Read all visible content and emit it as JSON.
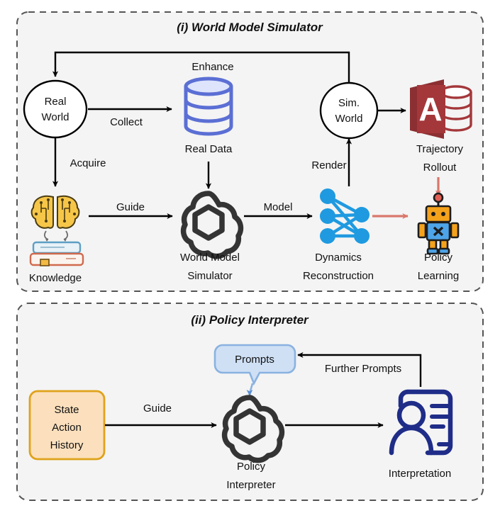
{
  "figure": {
    "background": "#ffffff",
    "panel_fill": "#f4f4f4",
    "panel_border": "#555555"
  },
  "panels": [
    {
      "id": "world-model-simulator",
      "title": "(i) World Model Simulator"
    },
    {
      "id": "policy-interpreter",
      "title": "(ii) Policy Interpreter"
    }
  ],
  "panel1": {
    "nodes": {
      "real_world_line1": "Real",
      "real_world_line2": "World",
      "sim_world_line1": "Sim.",
      "sim_world_line2": "World"
    },
    "captions": {
      "real_data": "Real Data",
      "knowledge": "Knowledge",
      "world_model_line1": "World Model",
      "world_model_line2": "Simulator",
      "dynamics_line1": "Dynamics",
      "dynamics_line2": "Reconstruction",
      "trajectory_line1": "Trajectory",
      "trajectory_line2": "Rollout",
      "policy_line1": "Policy",
      "policy_line2": "Learning"
    },
    "edges": {
      "collect": "Collect",
      "enhance": "Enhance",
      "acquire": "Acquire",
      "guide": "Guide",
      "model": "Model",
      "render": "Render"
    },
    "icon_names": {
      "real_data": "database-icon",
      "knowledge": "brain-books-icon",
      "world_model": "openai-logo-icon",
      "dynamics": "neural-network-icon",
      "trajectory": "access-database-icon",
      "policy": "robot-icon"
    },
    "colors": {
      "database": "#5b6fd4",
      "database_top": "#dde4fb",
      "access_red": "#a4373a",
      "access_dark": "#8c2f32",
      "neural_blue": "#1f9ae0",
      "salmon_arrow": "#d9776b",
      "brain_yellow": "#f6c648",
      "robot_orange": "#f4a21c",
      "robot_blue": "#4ea4e8",
      "openai_dark": "#343434",
      "stroke": "#000000"
    }
  },
  "panel2": {
    "state_box": {
      "line1": "State",
      "line2": "Action",
      "line3": "History",
      "fill": "#fce0bd",
      "border": "#e0a21b"
    },
    "prompts_bubble": {
      "label": "Prompts",
      "fill": "#cfe0f5",
      "border": "#8ab2e0"
    },
    "captions": {
      "policy_line1": "Policy",
      "policy_line2": "Interpreter",
      "interpretation": "Interpretation"
    },
    "edges": {
      "guide": "Guide",
      "further_prompts": "Further Prompts"
    },
    "icon_names": {
      "policy_interpreter": "openai-logo-icon",
      "interpretation": "person-id-card-icon"
    },
    "colors": {
      "navy": "#1f2d88",
      "openai_dark": "#343434",
      "stroke": "#000000"
    }
  }
}
